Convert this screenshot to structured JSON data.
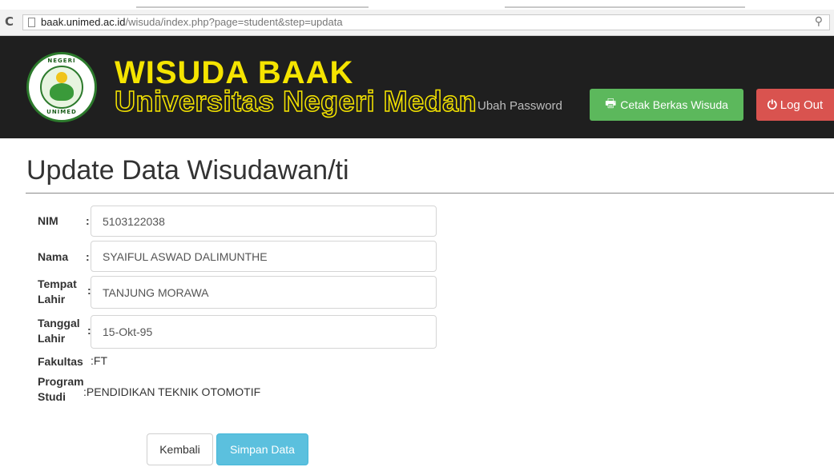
{
  "browser": {
    "url_domain": "baak.unimed.ac.id",
    "url_path": "/wisuda/index.php?page=student&step=updata",
    "reload_icon": "reload-icon",
    "zoom_icon": "zoom-icon"
  },
  "header": {
    "brand_title": "WISUDA BAAK",
    "brand_subtitle": "Universitas Negeri Medan",
    "logo_text_top": "NEGERI",
    "logo_text_bottom": "UNIMED",
    "change_password": "Ubah Password",
    "print_button": "Cetak Berkas Wisuda",
    "logout_button": "Log Out",
    "colors": {
      "background": "#1f1f1f",
      "brand": "#f5e400",
      "print": "#5cb85c",
      "logout": "#d9534f"
    }
  },
  "page": {
    "title": "Update Data Wisudawan/ti"
  },
  "form": {
    "colon": ":",
    "nim_label": "NIM",
    "nim_value": "5103122038",
    "nama_label": "Nama",
    "nama_value": "SYAIFUL ASWAD DALIMUNTHE",
    "tempat_label_1": "Tempat",
    "tempat_label_2": "Lahir",
    "tempat_value": "TANJUNG MORAWA",
    "tanggal_label_1": "Tanggal",
    "tanggal_label_2": "Lahir",
    "tanggal_value": "15-Okt-95",
    "fakultas_label": "Fakultas",
    "fakultas_value": ":FT",
    "prodi_label_1": "Program",
    "prodi_label_2": "Studi",
    "prodi_value": ":PENDIDIKAN TEKNIK OTOMOTIF",
    "back_button": "Kembali",
    "save_button": "Simpan Data",
    "colors": {
      "save": "#5bc0de"
    }
  }
}
